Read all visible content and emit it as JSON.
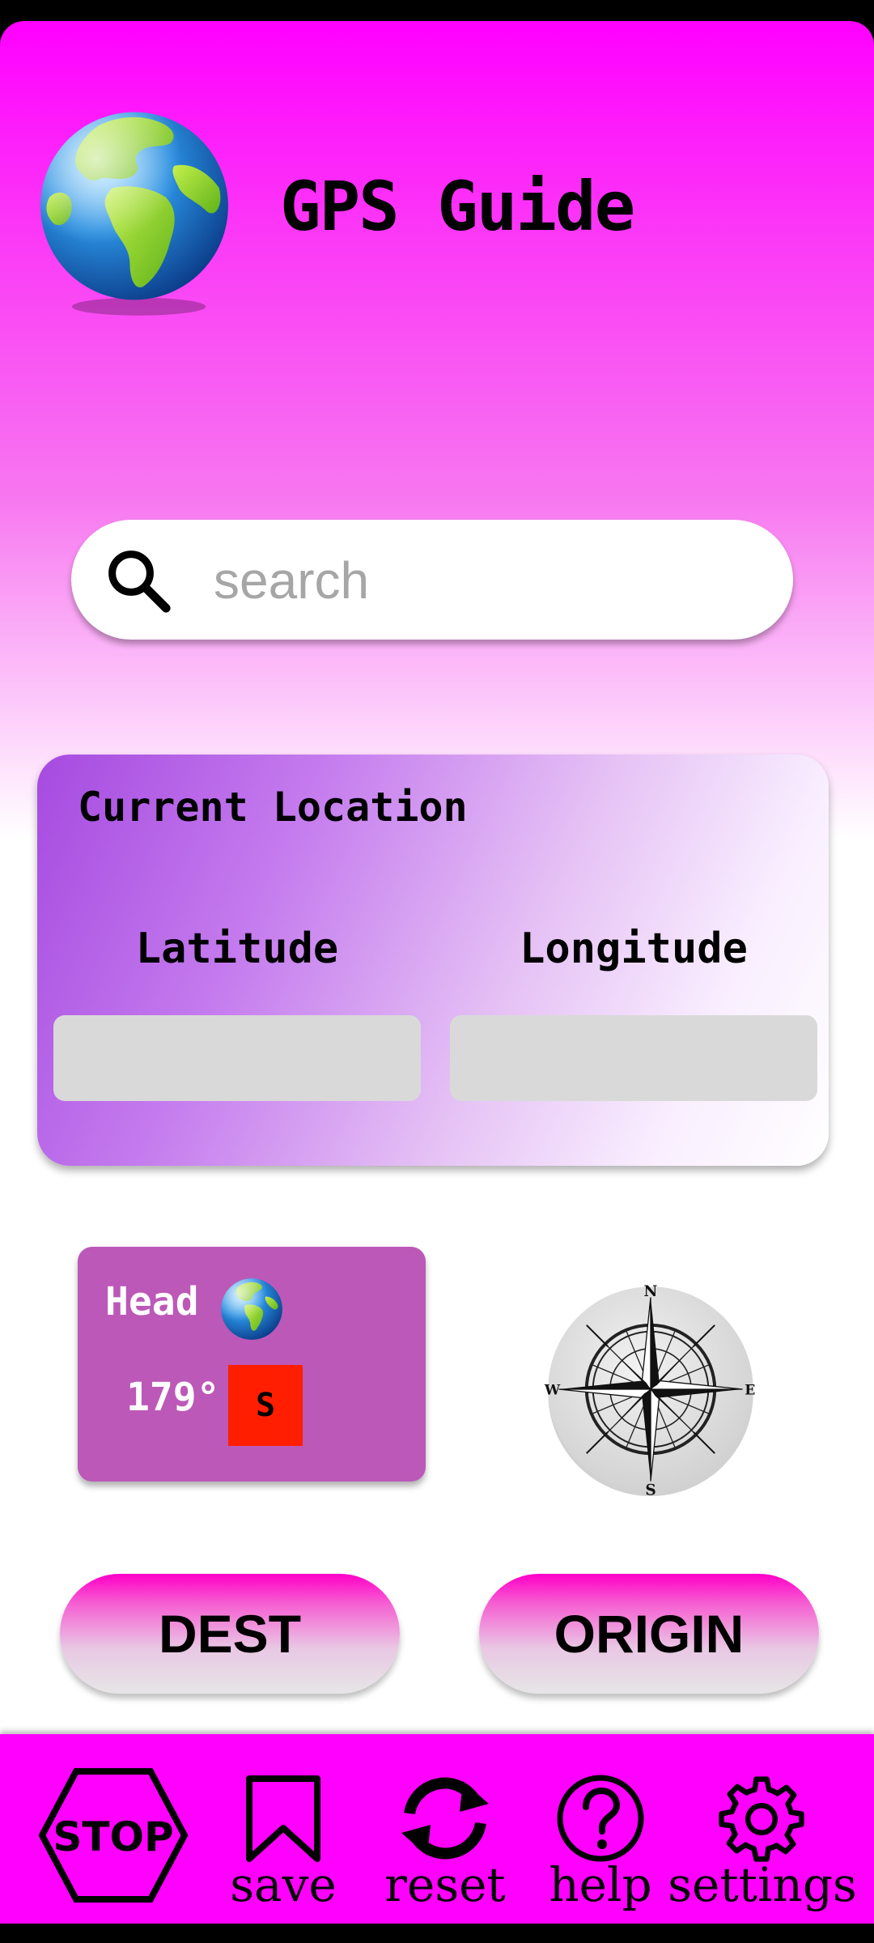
{
  "app": {
    "title": "GPS Guide",
    "logo_icon": "globe-icon"
  },
  "search": {
    "placeholder": "search",
    "value": ""
  },
  "current_location": {
    "title": "Current Location",
    "latitude_label": "Latitude",
    "longitude_label": "Longitude",
    "latitude_value": "",
    "longitude_value": ""
  },
  "heading": {
    "label": "Head",
    "degrees": "179°",
    "direction": "S",
    "icon": "globe-icon"
  },
  "compass": {
    "icon": "compass-rose-icon",
    "north": "N",
    "south": "S",
    "east": "E",
    "west": "W"
  },
  "buttons": {
    "dest": "DEST",
    "origin": "ORIGIN"
  },
  "nav": {
    "stop": "STOP",
    "save": "save",
    "reset": "reset",
    "help": "help",
    "settings": "settings"
  },
  "colors": {
    "accent": "#ff00ff",
    "card": "#bc58b8",
    "direction_badge": "#ff1e00",
    "field": "#d9d9d9"
  }
}
